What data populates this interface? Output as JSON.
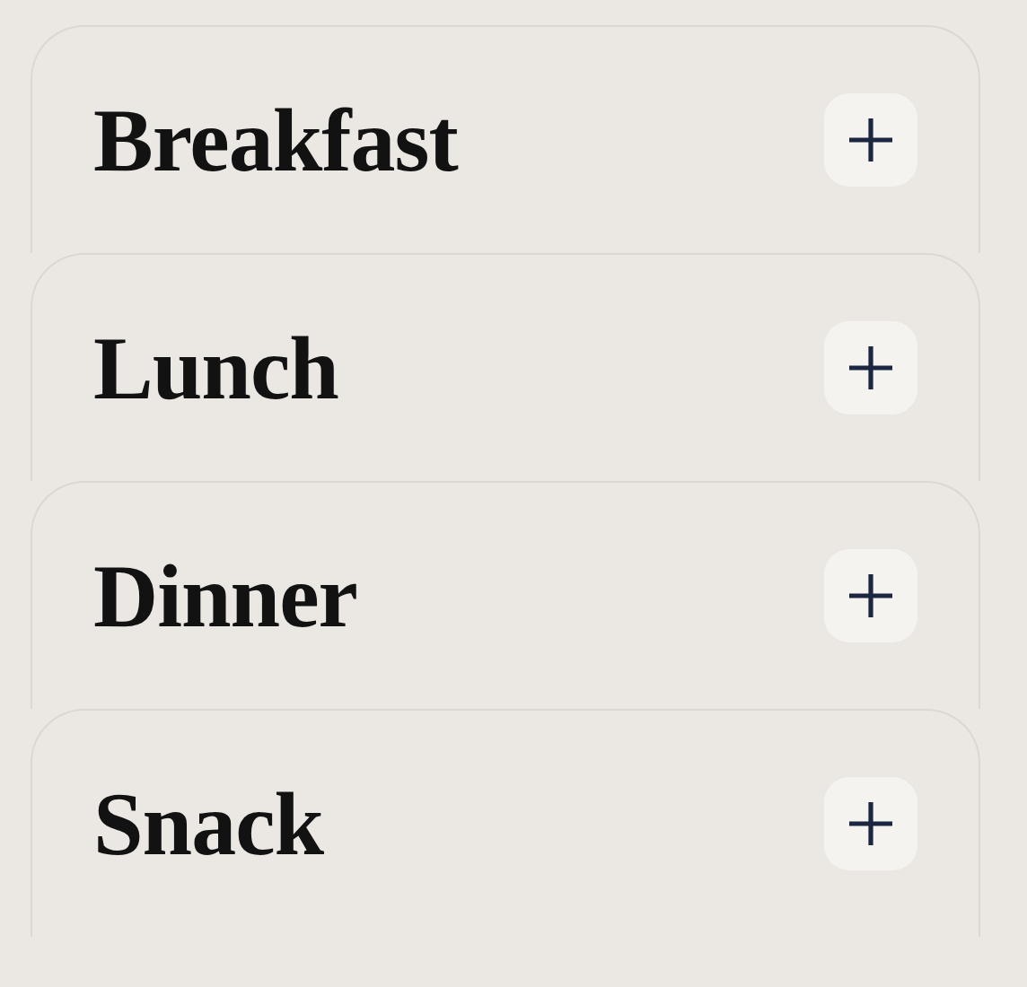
{
  "meals": [
    {
      "title": "Breakfast"
    },
    {
      "title": "Lunch"
    },
    {
      "title": "Dinner"
    },
    {
      "title": "Snack"
    }
  ]
}
